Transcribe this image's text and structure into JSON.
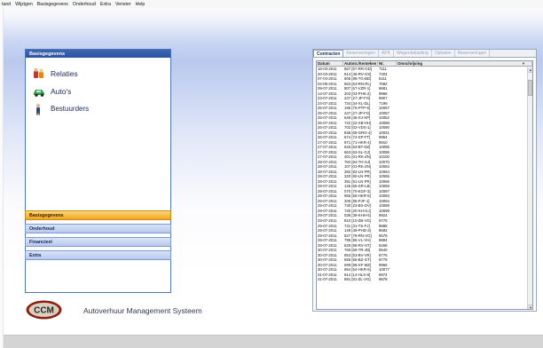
{
  "menu": [
    "tand",
    "Wijzigen",
    "Basisgegevens",
    "Onderhoud",
    "Extra",
    "Venster",
    "Help"
  ],
  "nav": {
    "header": "Basisgegevens",
    "items": [
      {
        "label": "Relaties",
        "icon": "relations-icon"
      },
      {
        "label": "Auto's",
        "icon": "car-icon"
      },
      {
        "label": "Bestuurders",
        "icon": "driver-icon"
      }
    ],
    "tabs": [
      "Basisgegevens",
      "Onderhoud",
      "Financieel",
      "Extra"
    ],
    "active_tab": 0
  },
  "app_title": "Autoverhuur Management Systeem",
  "logo_text": "CCM",
  "contracts": {
    "tabs": [
      "Contracten",
      "Reserveringen",
      "APK",
      "Wegenbelasting",
      "Ophalen",
      "Reserveringen"
    ],
    "active_tab": 0,
    "columns": [
      "Datum",
      "Autonr./Kenteken",
      "Nr.",
      "Omschrijving"
    ],
    "rows": [
      [
        "16-03-2011",
        "567 [67-RR-GD]",
        "7111"
      ],
      [
        "20-03-2011",
        "614 [46-RV-GS]",
        "7404"
      ],
      [
        "07-04-2011",
        "605 [85-TG-BD]",
        "5111"
      ],
      [
        "04-05-2011",
        "563 [63-RN-RL]",
        "7682"
      ],
      [
        "09-07-2011",
        "907 [67-VZR-1]",
        "9681"
      ],
      [
        "14-07-2011",
        "203 [03-PHK-2]",
        "9968"
      ],
      [
        "23-07-2011",
        "247 [27-JP-FG]",
        "9907"
      ],
      [
        "24-07-2011",
        "734 [34-XL-DL]",
        "7199"
      ],
      [
        "25-07-2011",
        "195 [75-PTP-9]",
        "10057"
      ],
      [
        "25-07-2011",
        "247 [27-JP-FG]",
        "10067"
      ],
      [
        "25-07-2011",
        "646 [46-SJ-XP]",
        "10052"
      ],
      [
        "26-07-2011",
        "722 [22-XB-HH]",
        "10088"
      ],
      [
        "26-07-2011",
        "702 [02-VDS-1]",
        "10090"
      ],
      [
        "26-07-2011",
        "836 [69-GRG-4]",
        "10021"
      ],
      [
        "26-07-2011",
        "674 [74-SP-FT]",
        "9954"
      ],
      [
        "27-07-2011",
        "971 [71-HKR-4]",
        "9910"
      ],
      [
        "27-07-2011",
        "626 [63-BT-DZ]",
        "10095"
      ],
      [
        "27-07-2011",
        "663 [63-SL-GJ]",
        "10096"
      ],
      [
        "27-07-2011",
        "401 [01-RK-ZN]",
        "10100"
      ],
      [
        "28-07-2011",
        "784 [84-TH-SJ]",
        "10070"
      ],
      [
        "28-07-2011",
        "107 [01-RK-ZN]",
        "10063"
      ],
      [
        "28-07-2011",
        "392 [92-LN-PR]",
        "10064"
      ],
      [
        "28-07-2011",
        "320 [90-LN-PR]",
        "10065"
      ],
      [
        "28-07-2011",
        "391 [91-LN-PR]",
        "10066"
      ],
      [
        "28-07-2011",
        "145 [65-SR-LB]",
        "10069"
      ],
      [
        "28-07-2011",
        "070 [70-KGF-3]",
        "10097"
      ],
      [
        "29-07-2011",
        "955 [55-HKR-6]",
        "10093"
      ],
      [
        "29-07-2011",
        "206 [86-PJF-1]",
        "10094"
      ],
      [
        "29-07-2011",
        "730 [23-BX-DV]",
        "10089"
      ],
      [
        "29-07-2011",
        "720 [20-XH-GJ]",
        "10099"
      ],
      [
        "29-07-2011",
        "038 [38-KHH-5]",
        "9924"
      ],
      [
        "29-07-2011",
        "810 [10-ZB-VG]",
        "9775"
      ],
      [
        "29-07-2011",
        "731 [31-TS-FJ]",
        "9888"
      ],
      [
        "29-07-2011",
        "149 [49-PHD-3]",
        "8693"
      ],
      [
        "29-07-2011",
        "527 [78-RN-VG]",
        "9579"
      ],
      [
        "29-07-2011",
        "795 [95-VL-VH]",
        "8894"
      ],
      [
        "29-07-2011",
        "529 [95-RV-HT]",
        "5268"
      ],
      [
        "30-07-2011",
        "766 [66-TR-JD]",
        "9540"
      ],
      [
        "30-07-2011",
        "653 [53-BV-VR]",
        "9776"
      ],
      [
        "30-07-2011",
        "655 [55-BZ-GT]",
        "9779"
      ],
      [
        "30-07-2011",
        "699 [99-XF-MZ]",
        "9966"
      ],
      [
        "30-07-2011",
        "954 [54-HKR-6]",
        "10077"
      ],
      [
        "31-07-2011",
        "914 [14-HLX-9]",
        "9974"
      ],
      [
        "31-07-2011",
        "891 [81-ZL-VG]",
        "9878"
      ]
    ]
  }
}
